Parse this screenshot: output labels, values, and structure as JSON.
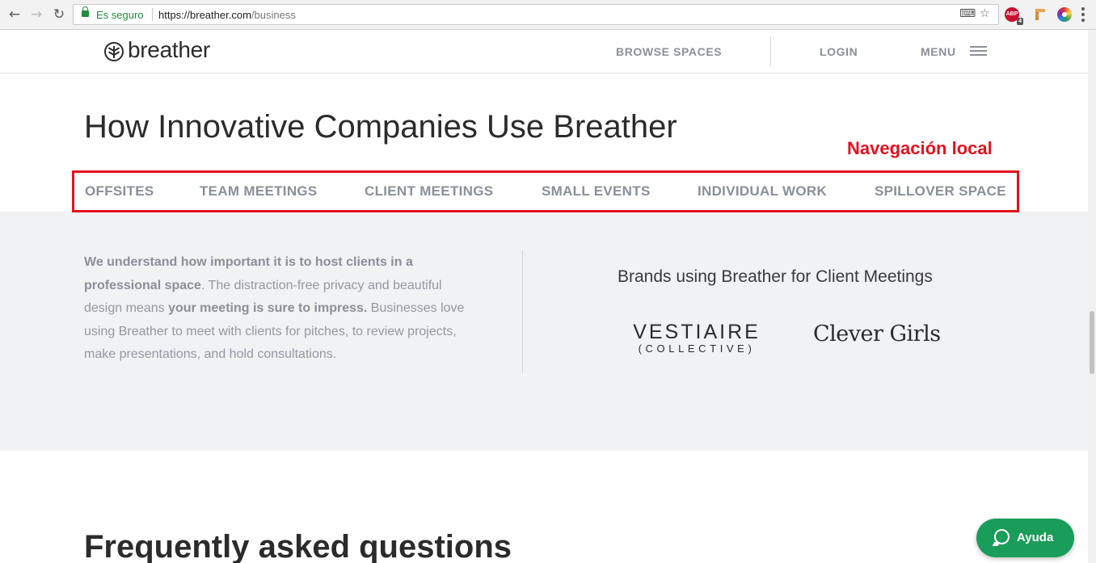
{
  "browser": {
    "security_label": "Es seguro",
    "url_host": "https://breather.com",
    "url_path": "/business",
    "extension_badge_text": "ABP",
    "extension_badge_count": "4"
  },
  "header": {
    "logo_text": "breather",
    "browse_spaces": "BROWSE SPACES",
    "login": "LOGIN",
    "menu": "MENU"
  },
  "hero": {
    "title": "How Innovative Companies Use Breather",
    "annotation": "Navegación local",
    "tabs": [
      {
        "label": "OFFSITES"
      },
      {
        "label": "TEAM MEETINGS"
      },
      {
        "label": "CLIENT MEETINGS"
      },
      {
        "label": "SMALL EVENTS"
      },
      {
        "label": "INDIVIDUAL WORK"
      },
      {
        "label": "SPILLOVER SPACE"
      }
    ]
  },
  "content": {
    "desc_bold1": "We understand how important it is to host clients in a professional space",
    "desc_text1": ". The distraction-free privacy and beautiful design means ",
    "desc_bold2": "your meeting is sure to impress.",
    "desc_text2": " Businesses love using Breather to meet with clients for pitches, to review projects, make presentations, and hold consultations.",
    "brands_title": "Brands using Breather for Client Meetings",
    "brand1_line1": "VESTIAIRE",
    "brand1_line2": "(COLLECTIVE)",
    "brand2": "Clever Girls"
  },
  "faq": {
    "title": "Frequently asked questions"
  },
  "help": {
    "label": "Ayuda"
  },
  "colors": {
    "annotation_red": "#e3121e",
    "help_green": "#1a9c5a",
    "band_grey": "#f1f2f4",
    "nav_grey": "#8a8f99"
  }
}
